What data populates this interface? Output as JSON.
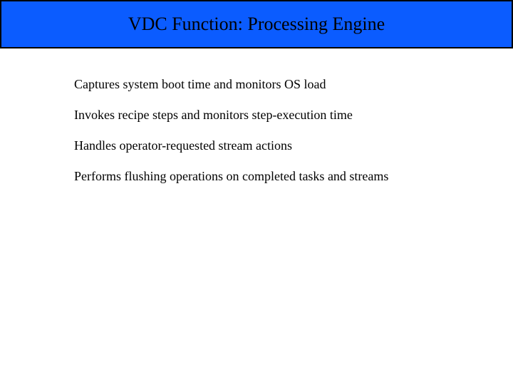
{
  "header": {
    "title": "VDC Function: Processing Engine"
  },
  "bullets": {
    "item0": "Captures system boot time and monitors OS load",
    "item1": "Invokes recipe steps and monitors step-execution time",
    "item2": "Handles operator-requested stream actions",
    "item3": "Performs flushing operations on completed tasks and streams"
  }
}
